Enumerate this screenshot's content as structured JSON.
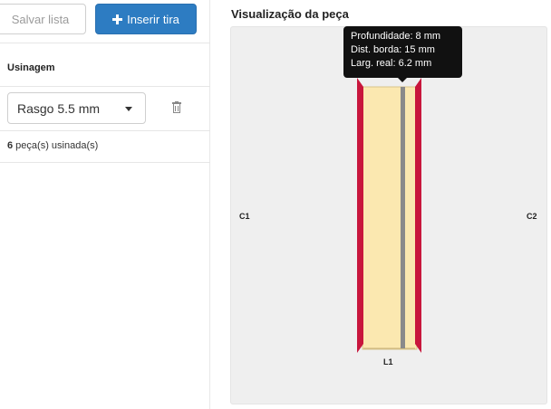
{
  "toolbar": {
    "save_label": "Salvar lista",
    "insert_label": "Inserir tira"
  },
  "machining": {
    "section_title": "Usinagem",
    "selected_option": "Rasgo 5.5 mm",
    "count_number": "6",
    "count_text": " peça(s) usinada(s)"
  },
  "preview": {
    "title": "Visualização da peça",
    "edges": {
      "left": "C1",
      "right": "C2",
      "bottom": "L1"
    },
    "tooltip": {
      "line1": "Profundidade: 8 mm",
      "line2": "Dist. borda: 15 mm",
      "line3": "Larg. real: 6.2 mm"
    }
  },
  "colors": {
    "primary_button": "#2d7cc2",
    "piece_fill": "#fbe8b0",
    "edge_band": "#c8163c",
    "groove": "#8a8a8a",
    "canvas_bg": "#efefef"
  }
}
